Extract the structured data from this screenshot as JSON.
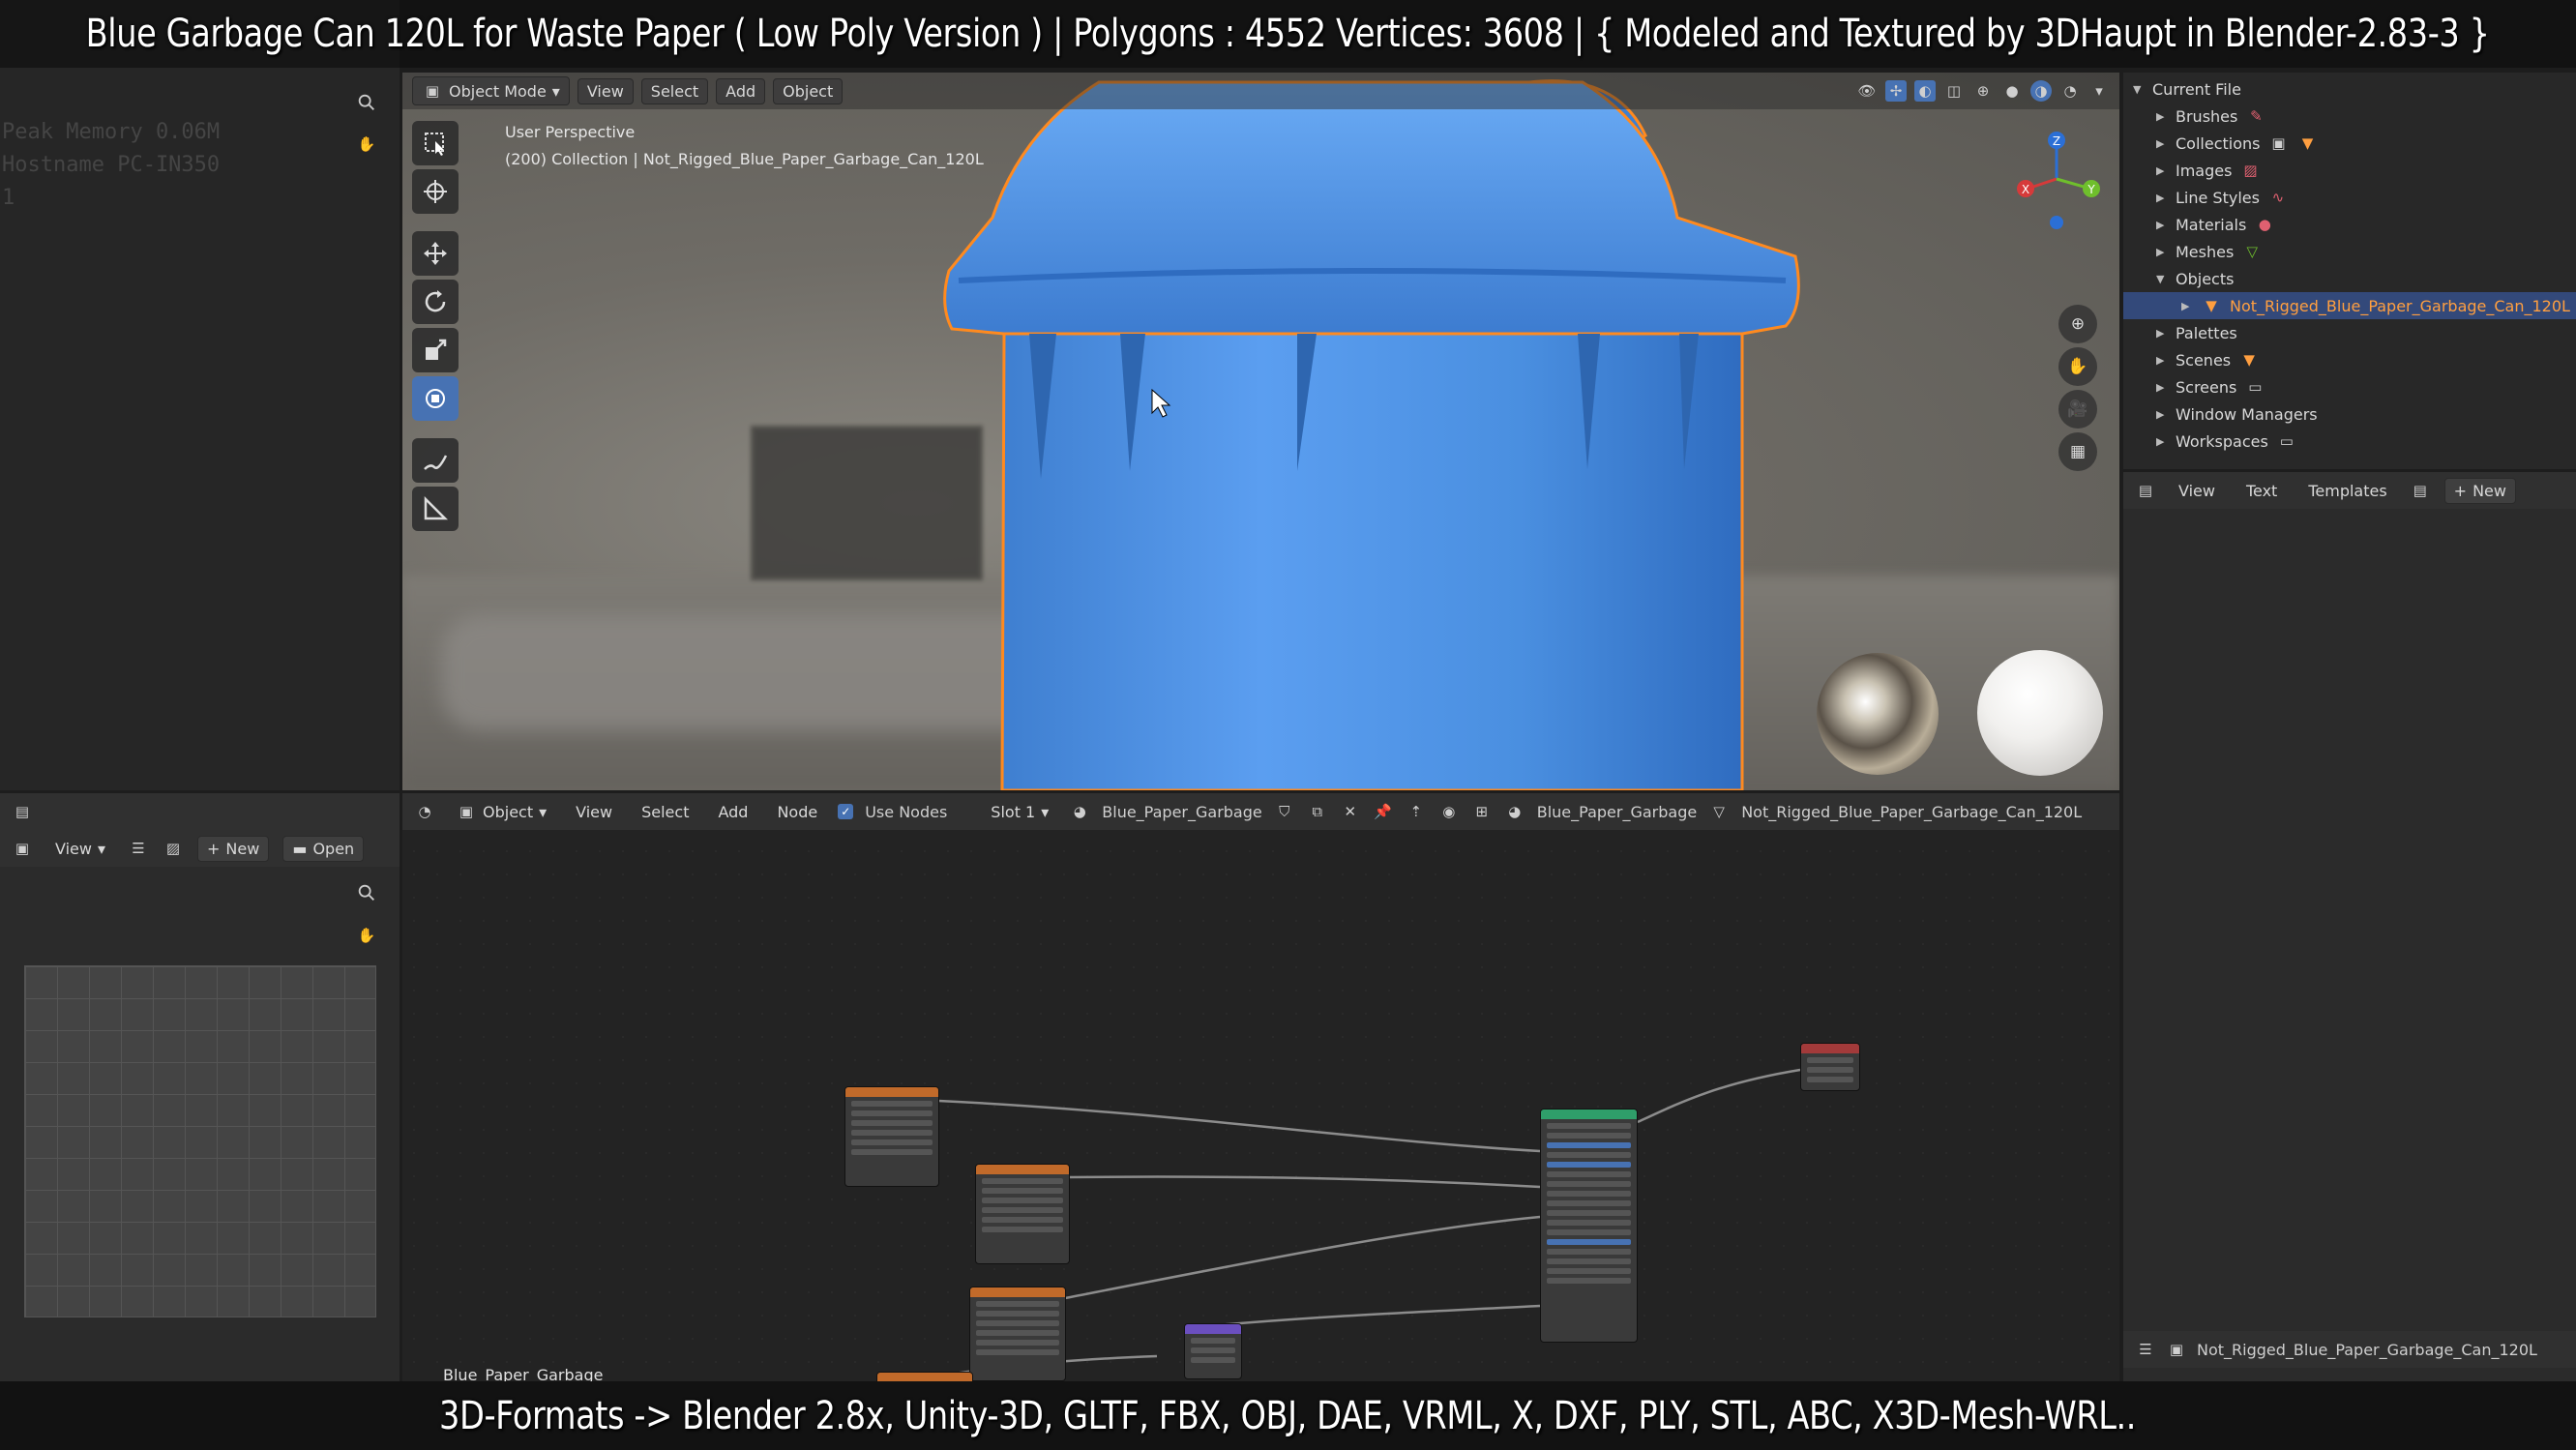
{
  "title_overlay": "Blue Garbage Can 120L for Waste Paper ( Low Poly Version ) |  Polygons : 4552  Vertices: 3608   |   { Modeled and Textured by 3DHaupt in Blender-2.83-3 }",
  "bottom_overlay": "3D-Formats -> Blender 2.8x, Unity-3D, GLTF, FBX, OBJ, DAE, VRML, X, DXF, PLY, STL, ABC, X3D-Mesh-WRL..",
  "left_text": {
    "lines": [
      "Peak Memory 0.06M",
      "Hostname PC-IN350",
      "1"
    ]
  },
  "viewport": {
    "mode": "Object Mode",
    "menus": [
      "View",
      "Select",
      "Add",
      "Object"
    ],
    "info_line1": "User Perspective",
    "info_line2": "(200) Collection | Not_Rigged_Blue_Paper_Garbage_Can_120L",
    "colors": {
      "can_blue": "#4a8fe0",
      "selection_outline": "#ff8a1f"
    }
  },
  "image_editor": {
    "view_label": "View",
    "new_label": "New",
    "open_label": "Open"
  },
  "node_editor": {
    "type": "Object",
    "menus": [
      "View",
      "Select",
      "Add",
      "Node"
    ],
    "use_nodes": "Use Nodes",
    "slot": "Slot 1",
    "material": "Blue_Paper_Garbage",
    "material_right": "Blue_Paper_Garbage",
    "object_name": "Not_Rigged_Blue_Paper_Garbage_Can_120L",
    "footer_label": "Blue_Paper_Garbage"
  },
  "outliner": {
    "root": "Current File",
    "items": [
      {
        "label": "Brushes",
        "icon": "brush-icon",
        "expanded": false
      },
      {
        "label": "Collections",
        "icon": "collection-icon",
        "expanded": false
      },
      {
        "label": "Images",
        "icon": "image-icon",
        "expanded": false
      },
      {
        "label": "Line Styles",
        "icon": "linestyle-icon",
        "expanded": false
      },
      {
        "label": "Materials",
        "icon": "material-icon",
        "expanded": false
      },
      {
        "label": "Meshes",
        "icon": "mesh-icon",
        "expanded": false
      },
      {
        "label": "Objects",
        "icon": "",
        "expanded": true
      },
      {
        "label": "Not_Rigged_Blue_Paper_Garbage_Can_120L",
        "icon": "object-icon",
        "selected": true
      },
      {
        "label": "Palettes",
        "icon": "",
        "expanded": false
      },
      {
        "label": "Scenes",
        "icon": "scene-icon",
        "expanded": false
      },
      {
        "label": "Screens",
        "icon": "screen-icon",
        "expanded": false
      },
      {
        "label": "Window Managers",
        "icon": "",
        "expanded": false
      },
      {
        "label": "Workspaces",
        "icon": "workspace-icon",
        "expanded": false
      }
    ]
  },
  "text_editor": {
    "menus": [
      "View",
      "Text",
      "Templates"
    ],
    "new_label": "New",
    "footer_object": "Not_Rigged_Blue_Paper_Garbage_Can_120L"
  }
}
